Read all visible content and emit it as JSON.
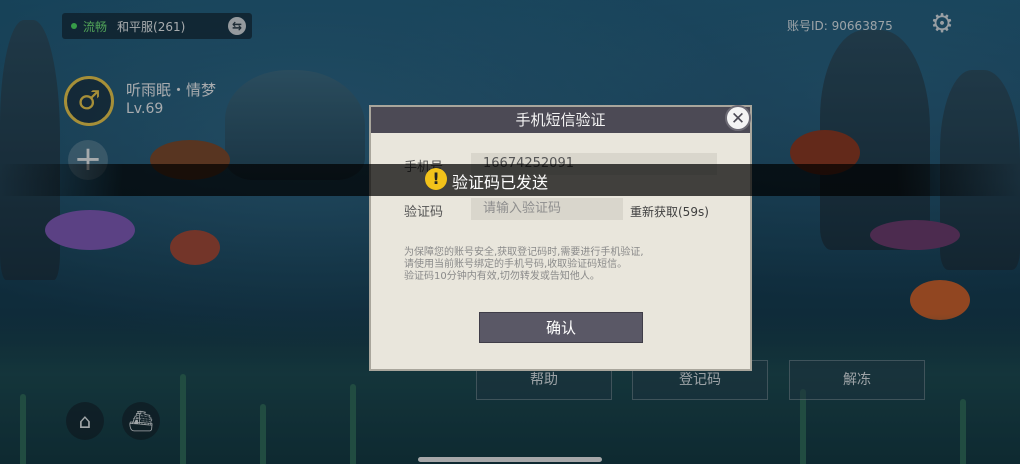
{
  "status": {
    "network": "流畅",
    "server": "和平服(261)"
  },
  "player": {
    "name": "听雨眠・情梦",
    "level": "Lv.69"
  },
  "account": {
    "id_label": "账号ID:",
    "id_value": "90663875"
  },
  "bottom_buttons": {
    "help": "帮助",
    "login_code": "登记码",
    "unfreeze": "解冻"
  },
  "dialog": {
    "title": "手机短信验证",
    "phone_label": "手机号",
    "phone_value": "16674252091",
    "code_label": "验证码",
    "code_placeholder": "请输入验证码",
    "resend": "重新获取(59s)",
    "notice_lines": [
      "为保障您的账号安全,获取登记码时,需要进行手机验证,",
      "请使用当前账号绑定的手机号码,收取验证码短信。",
      "验证码10分钟内有效,切勿转发或告知他人。"
    ],
    "confirm": "确认"
  },
  "toast": {
    "text": "验证码已发送"
  },
  "icons": {
    "gender": "male-icon",
    "add": "plus-icon",
    "settings": "gear-icon",
    "switch": "swap-icon",
    "close": "close-icon",
    "home": "home-icon",
    "ship": "ship-icon",
    "warning": "warning-icon"
  }
}
